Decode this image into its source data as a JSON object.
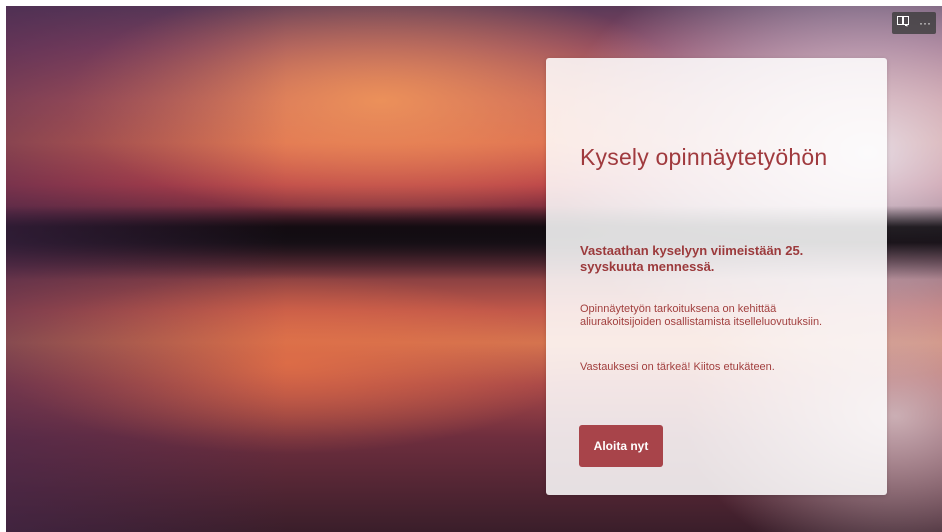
{
  "toolbar": {
    "icons": [
      "immersive-reader-icon",
      "more-options-icon"
    ],
    "more_label": "···"
  },
  "form": {
    "title": "Kysely opinnäytetyöhön",
    "subtitle": "Vastaathan kyselyyn viimeistään 25. syyskuuta mennessä.",
    "description": "Opinnäytetyön tarkoituksena on kehittää aliurakoitsijoiden osallistamista itselleluovutuksiin.",
    "thanks": "Vastauksesi on tärkeä! Kiitos etukäteen.",
    "start_label": "Aloita nyt"
  },
  "colors": {
    "accent": "#a8444a",
    "title_text": "#a03a3e"
  }
}
